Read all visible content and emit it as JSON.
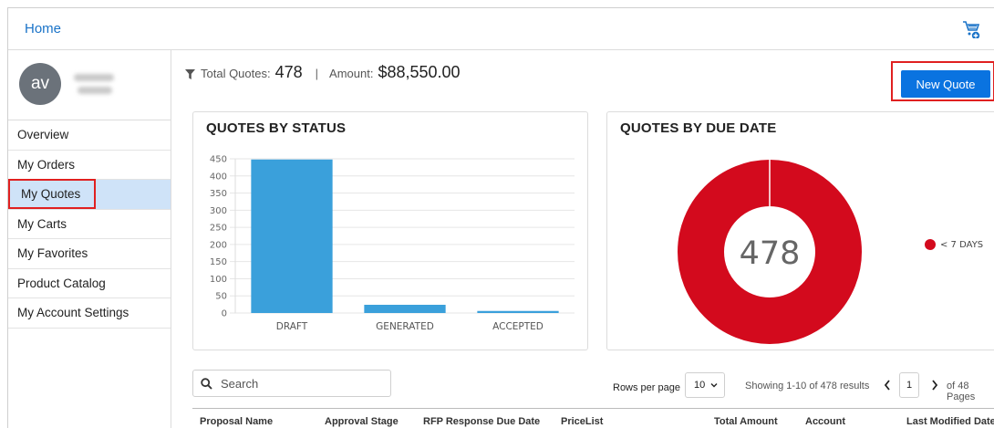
{
  "nav": {
    "home": "Home",
    "cart_icon": "cart-plus-icon"
  },
  "user": {
    "avatar_initials": "av"
  },
  "sidebar": {
    "items": [
      {
        "label": "Overview"
      },
      {
        "label": "My Orders"
      },
      {
        "label": "My Quotes",
        "active": true
      },
      {
        "label": "My Carts"
      },
      {
        "label": "My Favorites"
      },
      {
        "label": "Product Catalog"
      },
      {
        "label": "My Account Settings"
      }
    ]
  },
  "summary": {
    "total_label": "Total Quotes:",
    "total_value": "478",
    "separator": "|",
    "amount_label": "Amount:",
    "amount_value": "$88,550.00"
  },
  "actions": {
    "new_quote": "New Quote"
  },
  "colors": {
    "accent": "#0a73e0",
    "bar": "#3aa0db",
    "donut": "#d30a1d",
    "highlight": "#e02020",
    "active_nav": "#cfe3f8"
  },
  "chart_data": [
    {
      "type": "bar",
      "title": "QUOTES BY STATUS",
      "categories": [
        "DRAFT",
        "GENERATED",
        "ACCEPTED"
      ],
      "values": [
        448,
        24,
        6
      ],
      "ylim": [
        0,
        450
      ],
      "yticks": [
        0,
        50,
        100,
        150,
        200,
        250,
        300,
        350,
        400,
        450
      ],
      "grid": true
    },
    {
      "type": "pie",
      "variant": "donut",
      "title": "QUOTES BY DUE DATE",
      "center_label": "478",
      "slices": [
        {
          "label": "< 7 DAYS",
          "value": 478
        }
      ],
      "legend_position": "right"
    }
  ],
  "table_controls": {
    "search_placeholder": "Search",
    "rows_per_page_label": "Rows per page",
    "rows_per_page_value": "10",
    "showing": "Showing 1-10 of 478 results",
    "current_page": "1",
    "of_pages": "of 48 Pages"
  },
  "table": {
    "columns": [
      "Proposal Name",
      "Approval Stage",
      "RFP Response Due Date",
      "PriceList",
      "Total Amount",
      "Account",
      "Last Modified Date"
    ],
    "sort_indicator": "↓"
  }
}
